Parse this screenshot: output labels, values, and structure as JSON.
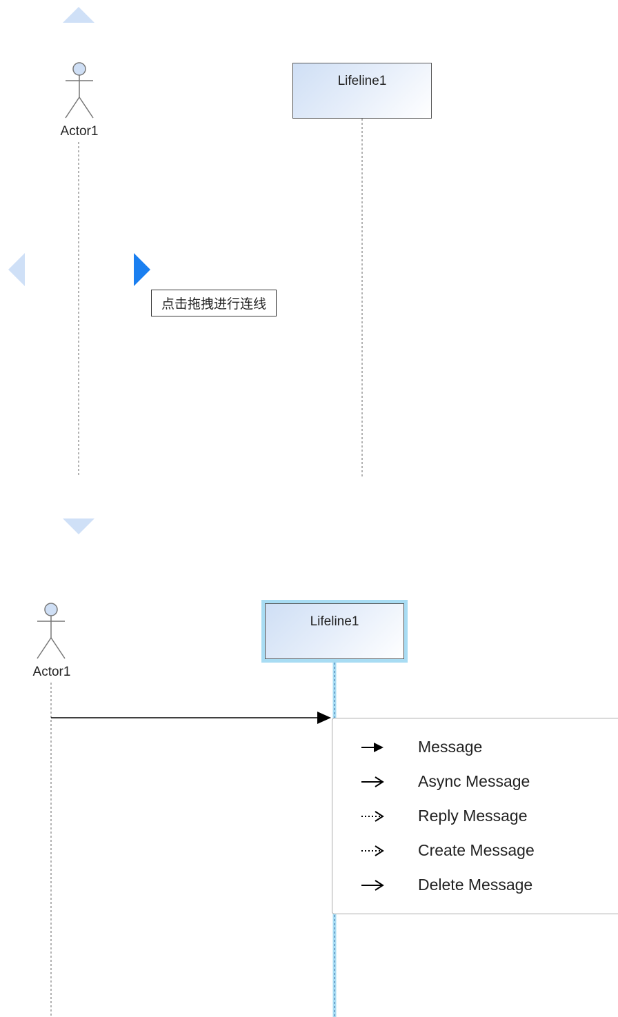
{
  "top_diagram": {
    "actor_label": "Actor1",
    "lifeline_label": "Lifeline1",
    "tooltip": "点击拖拽进行连线"
  },
  "bottom_diagram": {
    "actor_label": "Actor1",
    "lifeline_label": "Lifeline1",
    "menu_items": [
      {
        "label": "Message",
        "icon": "arrow-filled-solid-icon"
      },
      {
        "label": "Async Message",
        "icon": "arrow-open-solid-icon"
      },
      {
        "label": "Reply Message",
        "icon": "arrow-open-dotted-icon"
      },
      {
        "label": "Create Message",
        "icon": "arrow-open-dotted-icon"
      },
      {
        "label": "Delete Message",
        "icon": "arrow-open-solid-icon"
      }
    ]
  },
  "colors": {
    "handle_light": "#cfe0f7",
    "handle_active": "#1a7ff0",
    "selection": "#a8dcf3",
    "lifeline_selected": "#3ba3d6"
  }
}
